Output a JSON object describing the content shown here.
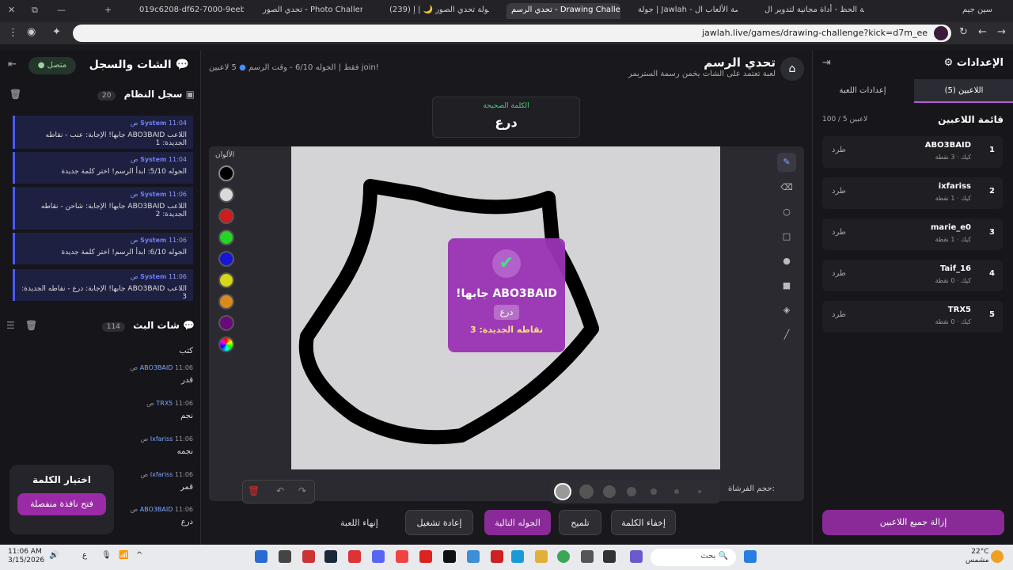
{
  "browser": {
    "tabs": [
      {
        "label": "سين جيم",
        "active": false
      },
      {
        "label": "عجلة الحظ - أداة مجانية لتدوير ال",
        "active": false
      },
      {
        "label": "جولة | Jawlah - منصة الألعاب ال",
        "active": false
      },
      {
        "label": "تحدي الرسم - Drawing Challenge",
        "active": true
      },
      {
        "label": "(239) بطولة تحدي الصور 🌙 | إ",
        "active": false
      },
      {
        "label": "تحدي الصور - Photo Challenge",
        "active": false
      },
      {
        "label": "019c6208-df62-7000-9eeb-9d",
        "active": false
      }
    ],
    "url": "jawlah.live/games/drawing-challenge?kick=d7m_ee"
  },
  "chat": {
    "title": "الشات والسجل",
    "status": "متصل",
    "system_log_title": "سجل النظام",
    "system_log_count": "20",
    "system_messages": [
      {
        "sender": "System",
        "time": "11:04 ص",
        "text": "اللاعب ABO3BAID جابها! الإجابة: عنب - نقاطه الجديدة: 1"
      },
      {
        "sender": "System",
        "time": "11:04 ص",
        "text": "الجوله 5/10: ابدأ الرسم! اختر كلمة جديدة"
      },
      {
        "sender": "System",
        "time": "11:06 ص",
        "text": "اللاعب ABO3BAID جابها! الإجابة: شاحن - نقاطه الجديدة: 2"
      },
      {
        "sender": "System",
        "time": "11:06 ص",
        "text": "الجوله 6/10: ابدأ الرسم! اختر كلمة جديدة"
      },
      {
        "sender": "System",
        "time": "11:06 ص",
        "text": "اللاعب ABO3BAID جابها! الإجابة: درع - نقاطه الجديدة: 3"
      }
    ],
    "stream_chat_title": "شات البث",
    "stream_chat_count": "114",
    "first_text": "كتب",
    "messages": [
      {
        "user": "ABO3BAID",
        "time": "11:06 ص",
        "text": "قدر"
      },
      {
        "user": "TRX5",
        "time": "11:06 ص",
        "text": "نجم"
      },
      {
        "user": "Ixfariss",
        "time": "11:06 ص",
        "text": "نجمه"
      },
      {
        "user": "Ixfariss",
        "time": "11:06 ص",
        "text": "قمر"
      },
      {
        "user": "ABO3BAID",
        "time": "11:06 ص",
        "text": "درع"
      }
    ],
    "pick_word_title": "اختيار الكلمة",
    "open_window_label": "فتح نافذة منفصلة"
  },
  "game": {
    "title": "تحدي الرسم",
    "subtitle": "لعبة تعتمد على الشات يخمن رسمة الستريمر",
    "players_stat": "5 لاعبين",
    "round_stat": "الجوله 6/10 - وقت الرسم",
    "join_stat": "!join فقط",
    "correct_word_label": "الكلمة الصحيحة",
    "correct_word": "درع",
    "colors_label": "الألوان",
    "colors": [
      "#000000",
      "#d9d9d9",
      "#d11a1a",
      "#22d622",
      "#1616d6",
      "#d6d61a",
      "#d98a1a",
      "#6a0a7a"
    ],
    "brush_size_label": "حجم الفرشاة:",
    "popup": {
      "title": "ABO3BAID جابها!",
      "word": "درع",
      "points": "نقاطه الجديدة: 3"
    },
    "buttons": {
      "hide_word": "إخفاء الكلمة",
      "hint": "تلميح",
      "next_round": "الجوله التالية",
      "restart": "إعادة تشغيل",
      "end_game": "إنهاء اللعبة"
    }
  },
  "settings": {
    "title": "الإعدادات",
    "tab_players": "اللاعبين (5)",
    "tab_game": "إعدادات اللعبة",
    "list_title": "قائمة اللاعبين",
    "list_count": "100 / 5 لاعبين",
    "players": [
      {
        "rank": "1",
        "name": "ABO3BAID",
        "info": "كيك · 3 نقطة",
        "kick": "طرد"
      },
      {
        "rank": "2",
        "name": "ixfariss",
        "info": "كيك · 1 نقطة",
        "kick": "طرد"
      },
      {
        "rank": "3",
        "name": "marie_e0",
        "info": "كيك · 1 نقطة",
        "kick": "طرد"
      },
      {
        "rank": "4",
        "name": "Taif_16",
        "info": "كيك · 0 نقطة",
        "kick": "طرد"
      },
      {
        "rank": "5",
        "name": "TRX5",
        "info": "كيك · 0 نقطة",
        "kick": "طرد"
      }
    ],
    "remove_all": "إزالة جميع اللاعبين"
  },
  "taskbar": {
    "time": "11:06 AM",
    "date": "3/15/2026",
    "lang": "ع",
    "search": "بحث",
    "weather_temp": "22°C",
    "weather_desc": "مشمس"
  }
}
